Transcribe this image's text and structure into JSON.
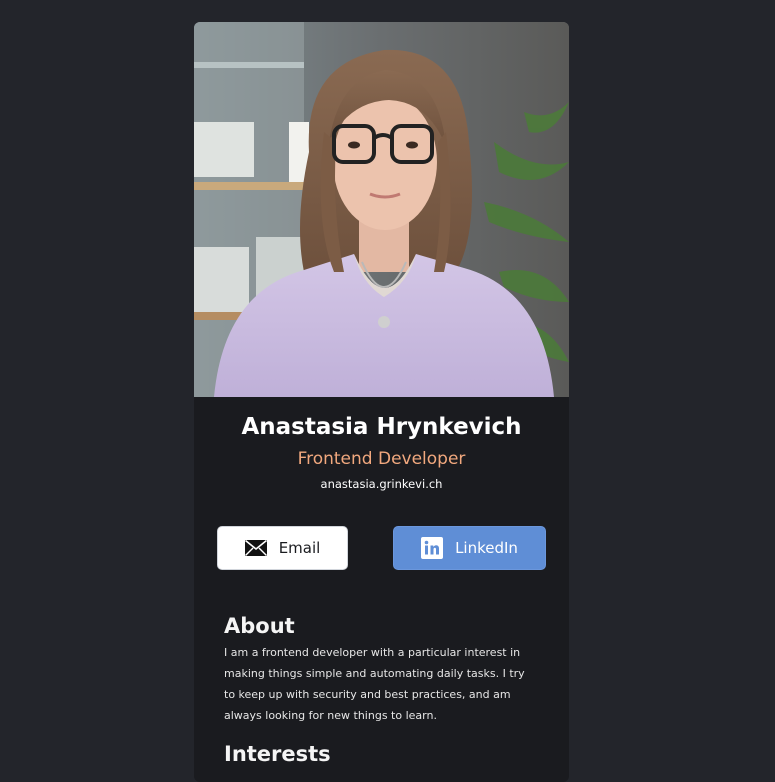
{
  "profile": {
    "name": "Anastasia Hrynkevich",
    "role": "Frontend Developer",
    "website": "anastasia.grinkevi.ch",
    "photo_alt": "Portrait photo of a woman with glasses wearing a lilac sweater"
  },
  "buttons": {
    "email_label": "Email",
    "email_icon": "envelope-icon",
    "linkedin_label": "LinkedIn",
    "linkedin_icon": "linkedin-icon"
  },
  "about": {
    "title": "About",
    "text": "I am a frontend developer with a particular interest in making things simple and automating daily tasks. I try to keep up with security and best practices, and am always looking for new things to learn."
  },
  "interests": {
    "title": "Interests"
  },
  "colors": {
    "page_background": "#23252b",
    "card_background": "#1a1b1f",
    "role_accent": "#f1a87e",
    "linkedin_button": "#5f8ed6",
    "email_button": "#ffffff"
  }
}
